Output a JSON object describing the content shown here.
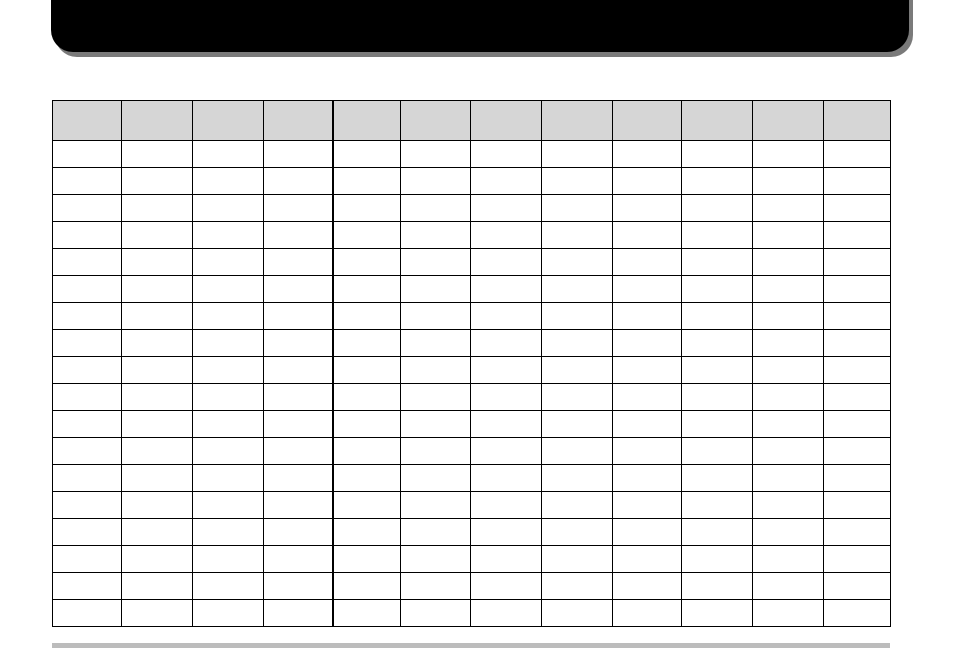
{
  "banner": {
    "title": ""
  },
  "table": {
    "headers": [
      "",
      "",
      "",
      "",
      "",
      "",
      "",
      "",
      "",
      "",
      "",
      ""
    ],
    "rows": [
      [
        "",
        "",
        "",
        "",
        "",
        "",
        "",
        "",
        "",
        "",
        "",
        ""
      ],
      [
        "",
        "",
        "",
        "",
        "",
        "",
        "",
        "",
        "",
        "",
        "",
        ""
      ],
      [
        "",
        "",
        "",
        "",
        "",
        "",
        "",
        "",
        "",
        "",
        "",
        ""
      ],
      [
        "",
        "",
        "",
        "",
        "",
        "",
        "",
        "",
        "",
        "",
        "",
        ""
      ],
      [
        "",
        "",
        "",
        "",
        "",
        "",
        "",
        "",
        "",
        "",
        "",
        ""
      ],
      [
        "",
        "",
        "",
        "",
        "",
        "",
        "",
        "",
        "",
        "",
        "",
        ""
      ],
      [
        "",
        "",
        "",
        "",
        "",
        "",
        "",
        "",
        "",
        "",
        "",
        ""
      ],
      [
        "",
        "",
        "",
        "",
        "",
        "",
        "",
        "",
        "",
        "",
        "",
        ""
      ],
      [
        "",
        "",
        "",
        "",
        "",
        "",
        "",
        "",
        "",
        "",
        "",
        ""
      ],
      [
        "",
        "",
        "",
        "",
        "",
        "",
        "",
        "",
        "",
        "",
        "",
        ""
      ],
      [
        "",
        "",
        "",
        "",
        "",
        "",
        "",
        "",
        "",
        "",
        "",
        ""
      ],
      [
        "",
        "",
        "",
        "",
        "",
        "",
        "",
        "",
        "",
        "",
        "",
        ""
      ],
      [
        "",
        "",
        "",
        "",
        "",
        "",
        "",
        "",
        "",
        "",
        "",
        ""
      ],
      [
        "",
        "",
        "",
        "",
        "",
        "",
        "",
        "",
        "",
        "",
        "",
        ""
      ],
      [
        "",
        "",
        "",
        "",
        "",
        "",
        "",
        "",
        "",
        "",
        "",
        ""
      ],
      [
        "",
        "",
        "",
        "",
        "",
        "",
        "",
        "",
        "",
        "",
        "",
        ""
      ],
      [
        "",
        "",
        "",
        "",
        "",
        "",
        "",
        "",
        "",
        "",
        "",
        ""
      ],
      [
        "",
        "",
        "",
        "",
        "",
        "",
        "",
        "",
        "",
        "",
        "",
        ""
      ]
    ]
  }
}
